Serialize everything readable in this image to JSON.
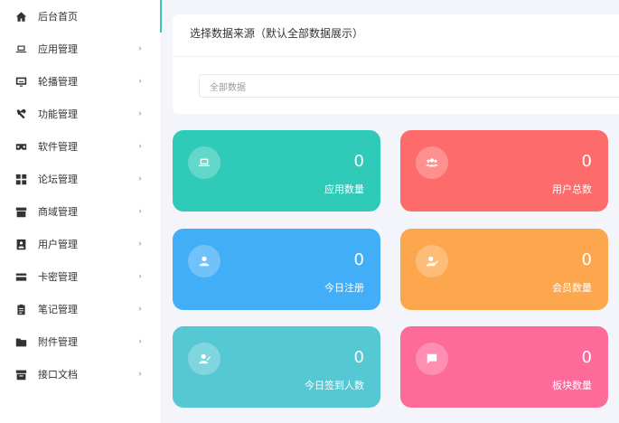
{
  "sidebar": {
    "items": [
      {
        "label": "后台首页",
        "icon": "home-icon",
        "active": true
      },
      {
        "label": "应用管理",
        "icon": "laptop-icon"
      },
      {
        "label": "轮播管理",
        "icon": "monitor-icon"
      },
      {
        "label": "功能管理",
        "icon": "tools-icon"
      },
      {
        "label": "软件管理",
        "icon": "vr-icon"
      },
      {
        "label": "论坛管理",
        "icon": "grid-icon"
      },
      {
        "label": "商域管理",
        "icon": "store-icon"
      },
      {
        "label": "用户管理",
        "icon": "id-badge-icon"
      },
      {
        "label": "卡密管理",
        "icon": "card-icon"
      },
      {
        "label": "笔记管理",
        "icon": "clipboard-icon"
      },
      {
        "label": "附件管理",
        "icon": "folder-icon"
      },
      {
        "label": "接口文档",
        "icon": "archive-icon"
      }
    ],
    "chevron": "›"
  },
  "source_panel": {
    "title": "选择数据来源（默认全部数据展示）",
    "select_value": "全部数据"
  },
  "cards": [
    {
      "value": "0",
      "label": "应用数量",
      "color": "#2fcab8",
      "icon": "laptop-icon"
    },
    {
      "value": "0",
      "label": "用户总数",
      "color": "#fe6b6b",
      "icon": "users-icon"
    },
    {
      "value": "0",
      "label": "今日注册",
      "color": "#42aef7",
      "icon": "user-icon"
    },
    {
      "value": "0",
      "label": "会员数量",
      "color": "#fca74d",
      "icon": "user-check-icon"
    },
    {
      "value": "0",
      "label": "今日签到人数",
      "color": "#56c8d3",
      "icon": "user-sign-icon"
    },
    {
      "value": "0",
      "label": "板块数量",
      "color": "#fe6a9a",
      "icon": "chat-icon"
    }
  ]
}
